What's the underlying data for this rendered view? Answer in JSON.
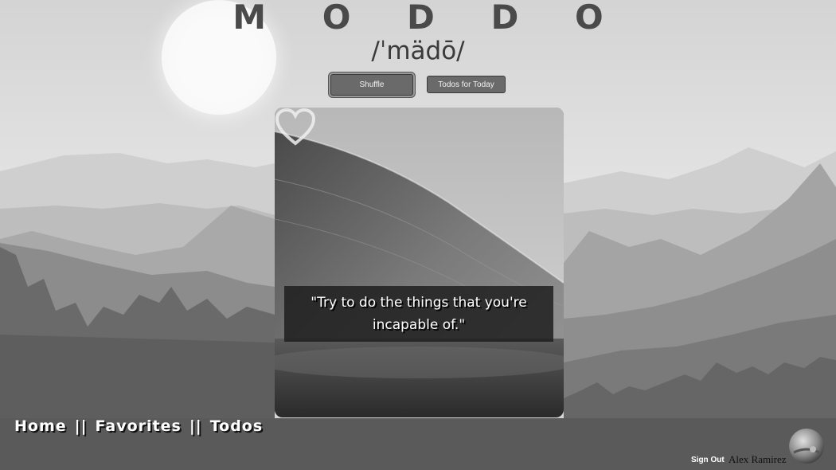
{
  "app": {
    "title": "M O D D O",
    "phonetic": "/ˈmädō/"
  },
  "toolbar": {
    "shuffle_label": "Shuffle",
    "todos_today_label": "Todos for Today"
  },
  "card": {
    "quote_line1": "\"Try to do the things that you're",
    "quote_line2": "incapable of.\"",
    "favorite_icon": "heart-outline-icon"
  },
  "nav": {
    "home": "Home",
    "separator": "||",
    "favorites": "Favorites",
    "todos": "Todos"
  },
  "user": {
    "sign_out_label": "Sign Out",
    "name": "Alex Ramirez",
    "avatar_icon": "avatar-image"
  }
}
